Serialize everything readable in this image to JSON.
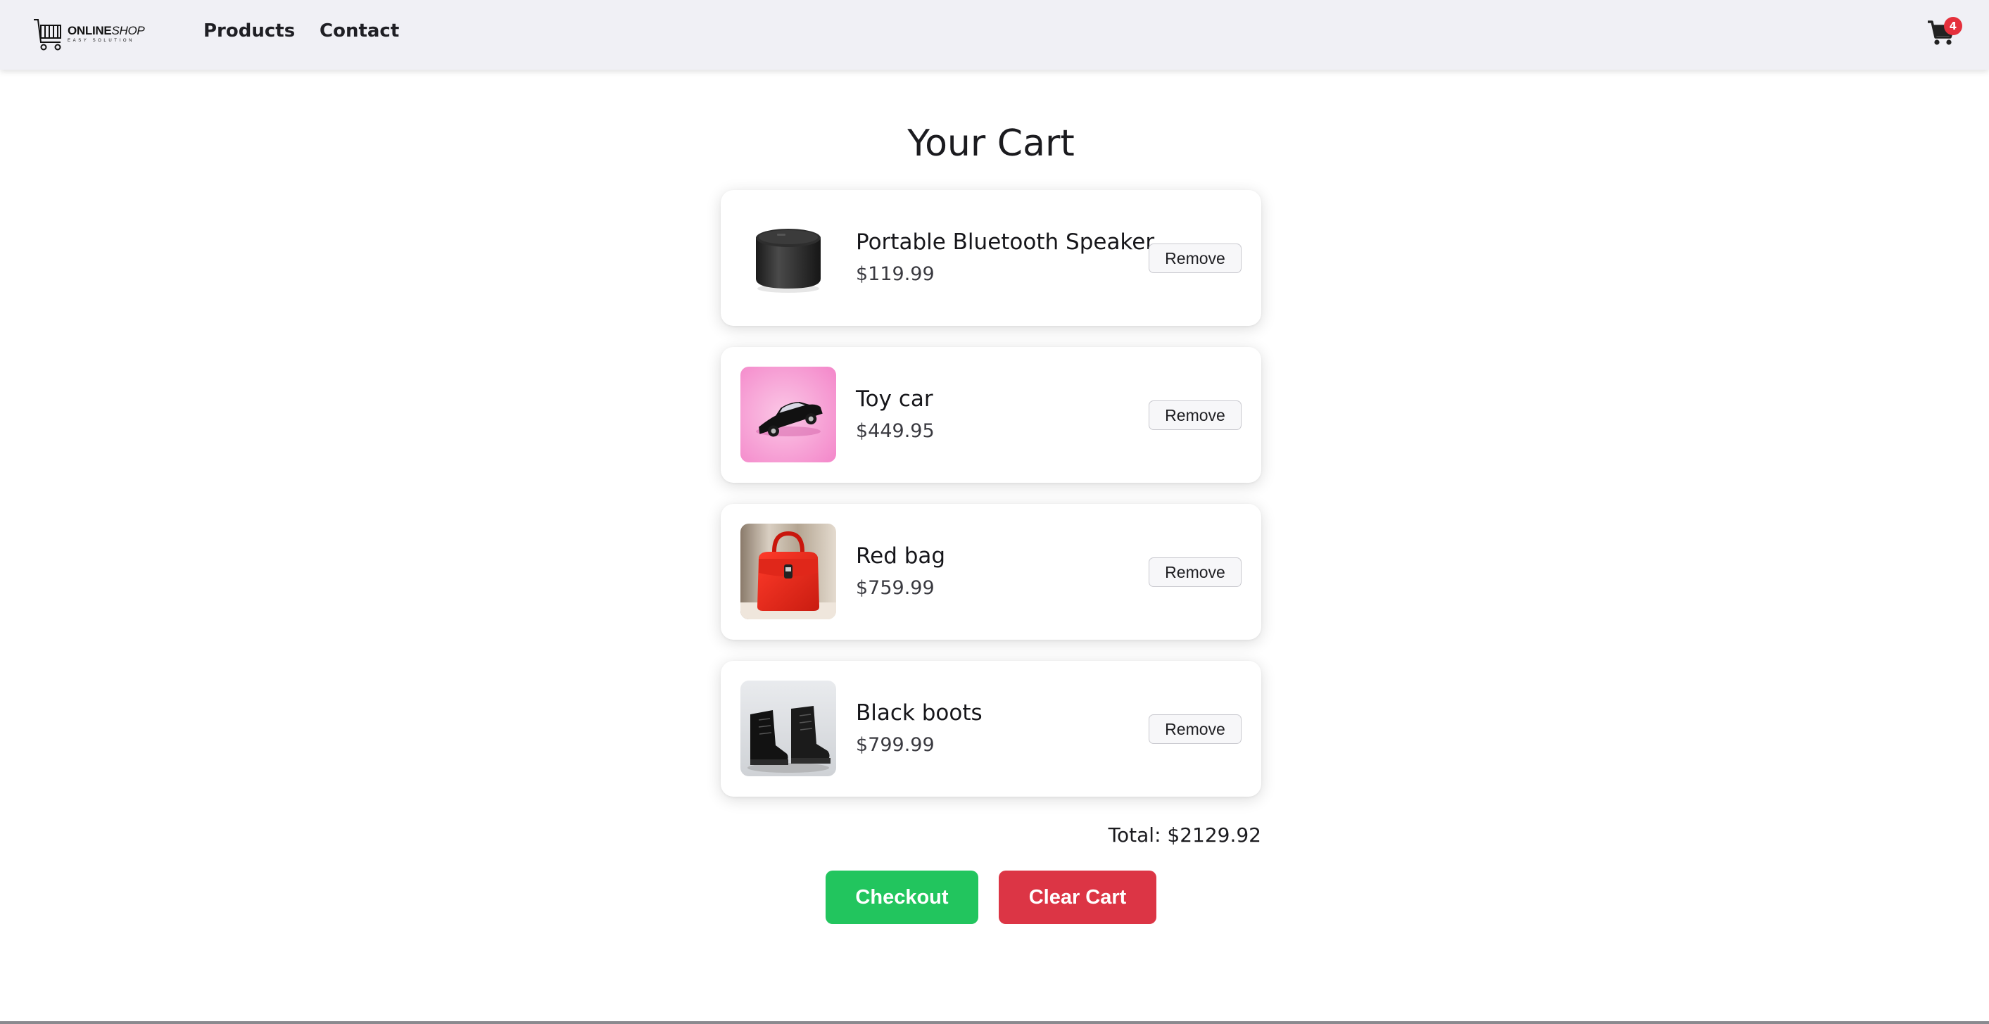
{
  "header": {
    "logo": {
      "main": "ONLINE",
      "main_accent": "SHOP",
      "tagline": "EASY SOLUTION"
    },
    "nav": [
      {
        "label": "Products"
      },
      {
        "label": "Contact"
      }
    ],
    "cart_icon": "shopping-cart-icon",
    "cart_count": "4"
  },
  "main": {
    "title": "Your Cart",
    "items": [
      {
        "name": "Portable Bluetooth Speaker",
        "price": "$119.99",
        "image": "speaker",
        "remove_label": "Remove"
      },
      {
        "name": "Toy car",
        "price": "$449.95",
        "image": "toy-car",
        "remove_label": "Remove"
      },
      {
        "name": "Red bag",
        "price": "$759.99",
        "image": "red-bag",
        "remove_label": "Remove"
      },
      {
        "name": "Black boots",
        "price": "$799.99",
        "image": "black-boots",
        "remove_label": "Remove"
      }
    ],
    "total_label": "Total: $2129.92",
    "checkout_label": "Checkout",
    "clear_label": "Clear Cart"
  },
  "colors": {
    "header_bg": "#f0f0f5",
    "checkout": "#22c55e",
    "clear": "#dc3545",
    "badge": "#e5303c"
  }
}
